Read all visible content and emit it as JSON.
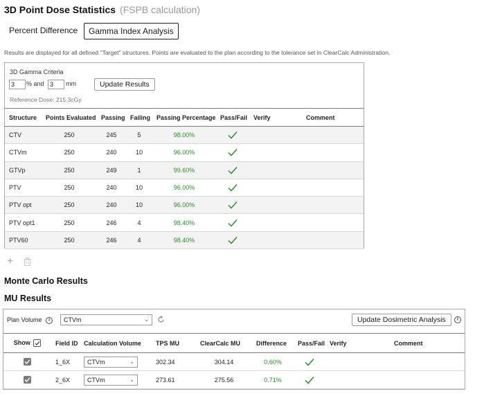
{
  "header": {
    "title": "3D Point Dose Statistics",
    "subtitle": "(FSPB calculation)"
  },
  "tabs": [
    {
      "label": "Percent Difference",
      "active": false
    },
    {
      "label": "Gamma Index Analysis",
      "active": true
    }
  ],
  "info_text": "Results are displayed for all defined \"Target\" structures. Points are evaluated to the plan according to the tolerance set in ClearCalc Administration.",
  "gamma_criteria": {
    "title": "3D Gamma Criteria",
    "percent_value": "3",
    "percent_label": "% and",
    "mm_value": "3",
    "mm_label": "mm",
    "update_button": "Update Results",
    "reference_dose": "Reference Dose: 215.3cGy"
  },
  "gamma_table": {
    "headers": [
      "Structure",
      "Points Evaluated",
      "Passing",
      "Failing",
      "Passing Percentage",
      "Pass/Fail",
      "Verify",
      "Comment"
    ],
    "rows": [
      {
        "structure": "CTV",
        "points": "250",
        "passing": "245",
        "failing": "5",
        "percentage": "98.00%",
        "pass": true
      },
      {
        "structure": "CTVm",
        "points": "250",
        "passing": "240",
        "failing": "10",
        "percentage": "96.00%",
        "pass": true
      },
      {
        "structure": "GTVp",
        "points": "250",
        "passing": "249",
        "failing": "1",
        "percentage": "99.60%",
        "pass": true
      },
      {
        "structure": "PTV",
        "points": "250",
        "passing": "240",
        "failing": "10",
        "percentage": "96.00%",
        "pass": true
      },
      {
        "structure": "PTV opt",
        "points": "250",
        "passing": "240",
        "failing": "10",
        "percentage": "96.00%",
        "pass": true
      },
      {
        "structure": "PTV opt1",
        "points": "250",
        "passing": "246",
        "failing": "4",
        "percentage": "98.40%",
        "pass": true
      },
      {
        "structure": "PTV60",
        "points": "250",
        "passing": "246",
        "failing": "4",
        "percentage": "98.40%",
        "pass": true
      }
    ]
  },
  "monte_carlo": {
    "title": "Monte Carlo Results"
  },
  "mu_results": {
    "title": "MU Results",
    "plan_volume_label": "Plan Volume",
    "plan_volume_value": "CTVm",
    "update_button": "Update Dosimetric Analysis",
    "headers": [
      "Show",
      "Field ID",
      "Calculation Volume",
      "TPS MU",
      "ClearCalc MU",
      "Difference",
      "Pass/Fail",
      "Verify",
      "Comment"
    ],
    "rows": [
      {
        "field_id": "1_6X",
        "calc_volume": "CTVm",
        "tps_mu": "302.34",
        "clearcalc_mu": "304.14",
        "difference": "0.60%",
        "pass": true
      },
      {
        "field_id": "2_6X",
        "calc_volume": "CTVm",
        "tps_mu": "273.61",
        "clearcalc_mu": "275.56",
        "difference": "0.71%",
        "pass": true
      }
    ]
  },
  "colors": {
    "pass_green": "#2e8b2e",
    "border": "#a9a9a9"
  }
}
